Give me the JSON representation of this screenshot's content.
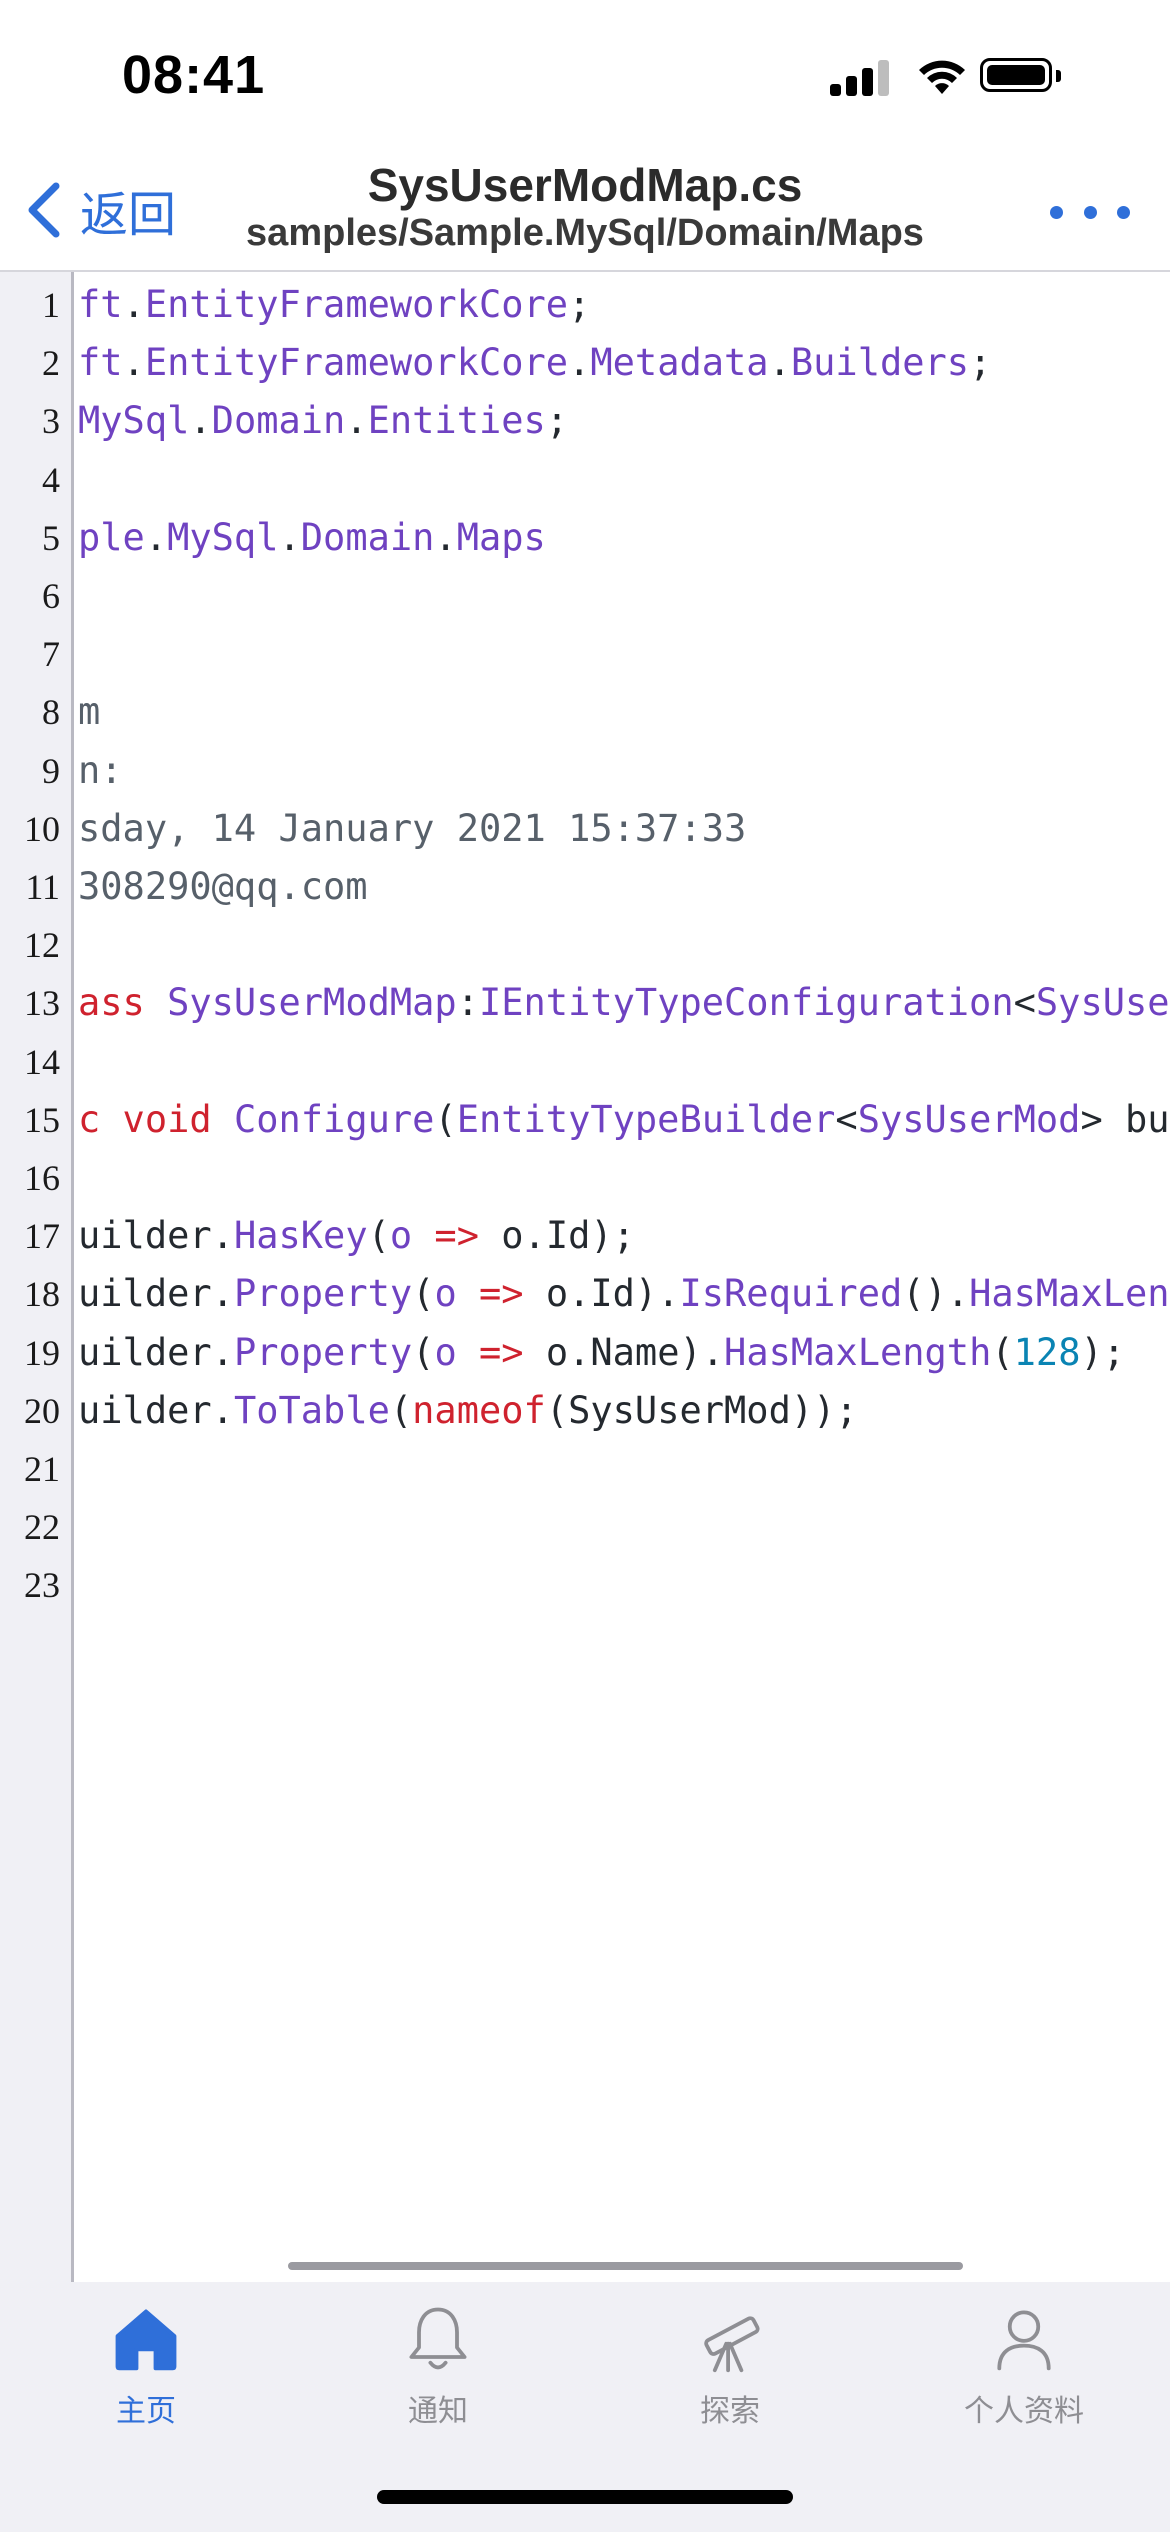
{
  "status_bar": {
    "time": "08:41"
  },
  "nav": {
    "back_label": "返回",
    "title": "SysUserModMap.cs",
    "subtitle": "samples/Sample.MySql/Domain/Maps"
  },
  "code_lines": [
    {
      "n": "1",
      "tokens": [
        [
          "ft",
          "purple"
        ],
        [
          ".",
          "plain"
        ],
        [
          "EntityFrameworkCore",
          "purple"
        ],
        [
          ";",
          "plain"
        ]
      ]
    },
    {
      "n": "2",
      "tokens": [
        [
          "ft",
          "purple"
        ],
        [
          ".",
          "plain"
        ],
        [
          "EntityFrameworkCore",
          "purple"
        ],
        [
          ".",
          "plain"
        ],
        [
          "Metadata",
          "purple"
        ],
        [
          ".",
          "plain"
        ],
        [
          "Builders",
          "purple"
        ],
        [
          ";",
          "plain"
        ]
      ]
    },
    {
      "n": "3",
      "tokens": [
        [
          "MySql",
          "purple"
        ],
        [
          ".",
          "plain"
        ],
        [
          "Domain",
          "purple"
        ],
        [
          ".",
          "plain"
        ],
        [
          "Entities",
          "purple"
        ],
        [
          ";",
          "plain"
        ]
      ]
    },
    {
      "n": "4",
      "tokens": []
    },
    {
      "n": "5",
      "tokens": [
        [
          "ple",
          "purple"
        ],
        [
          ".",
          "plain"
        ],
        [
          "MySql",
          "purple"
        ],
        [
          ".",
          "plain"
        ],
        [
          "Domain",
          "purple"
        ],
        [
          ".",
          "plain"
        ],
        [
          "Maps",
          "purple"
        ]
      ]
    },
    {
      "n": "6",
      "tokens": []
    },
    {
      "n": "7",
      "tokens": []
    },
    {
      "n": "8",
      "tokens": [
        [
          "m",
          "gray"
        ]
      ]
    },
    {
      "n": "9",
      "tokens": [
        [
          "n:",
          "gray"
        ]
      ]
    },
    {
      "n": "10",
      "tokens": [
        [
          "sday, 14 January 2021 15:37:33",
          "gray"
        ]
      ]
    },
    {
      "n": "11",
      "tokens": [
        [
          "308290@qq.com",
          "gray"
        ]
      ]
    },
    {
      "n": "12",
      "tokens": []
    },
    {
      "n": "13",
      "tokens": [
        [
          "ass ",
          "red"
        ],
        [
          "SysUserModMap",
          "purple"
        ],
        [
          ":",
          "plain"
        ],
        [
          "IEntityTypeConfiguration",
          "purple"
        ],
        [
          "<",
          "plain"
        ],
        [
          "SysUserMod",
          "purple"
        ]
      ]
    },
    {
      "n": "14",
      "tokens": []
    },
    {
      "n": "15",
      "tokens": [
        [
          "c void ",
          "red"
        ],
        [
          "Configure",
          "purple"
        ],
        [
          "(",
          "plain"
        ],
        [
          "EntityTypeBuilder",
          "purple"
        ],
        [
          "<",
          "plain"
        ],
        [
          "SysUserMod",
          "purple"
        ],
        [
          "> builder)",
          "plain"
        ]
      ]
    },
    {
      "n": "16",
      "tokens": []
    },
    {
      "n": "17",
      "tokens": [
        [
          "uilder.",
          "plain"
        ],
        [
          "HasKey",
          "purple"
        ],
        [
          "(",
          "plain"
        ],
        [
          "o",
          "purple"
        ],
        [
          " => ",
          "red"
        ],
        [
          "o.Id);",
          "plain"
        ]
      ]
    },
    {
      "n": "18",
      "tokens": [
        [
          "uilder.",
          "plain"
        ],
        [
          "Property",
          "purple"
        ],
        [
          "(",
          "plain"
        ],
        [
          "o",
          "purple"
        ],
        [
          " => ",
          "red"
        ],
        [
          "o.Id).",
          "plain"
        ],
        [
          "IsRequired",
          "purple"
        ],
        [
          "().",
          "plain"
        ],
        [
          "HasMaxLength",
          "purple"
        ]
      ]
    },
    {
      "n": "19",
      "tokens": [
        [
          "uilder.",
          "plain"
        ],
        [
          "Property",
          "purple"
        ],
        [
          "(",
          "plain"
        ],
        [
          "o",
          "purple"
        ],
        [
          " => ",
          "red"
        ],
        [
          "o.Name).",
          "plain"
        ],
        [
          "HasMaxLength",
          "purple"
        ],
        [
          "(",
          "plain"
        ],
        [
          "128",
          "num"
        ],
        [
          ");",
          "plain"
        ]
      ]
    },
    {
      "n": "20",
      "tokens": [
        [
          "uilder.",
          "plain"
        ],
        [
          "ToTable",
          "purple"
        ],
        [
          "(",
          "plain"
        ],
        [
          "nameof",
          "red"
        ],
        [
          "(SysUserMod));",
          "plain"
        ]
      ]
    },
    {
      "n": "21",
      "tokens": []
    },
    {
      "n": "22",
      "tokens": []
    },
    {
      "n": "23",
      "tokens": []
    }
  ],
  "tabs": [
    {
      "label": "主页",
      "icon": "home-icon",
      "active": true
    },
    {
      "label": "通知",
      "icon": "bell-icon",
      "active": false
    },
    {
      "label": "探索",
      "icon": "telescope-icon",
      "active": false
    },
    {
      "label": "个人资料",
      "icon": "person-icon",
      "active": false
    }
  ],
  "colors": {
    "accent": "#2f6fd9",
    "inactive": "#8e8e93",
    "code_purple": "#6f42c1",
    "code_red": "#cf222e",
    "code_gray": "#57606a",
    "code_number": "#0a84b3"
  }
}
